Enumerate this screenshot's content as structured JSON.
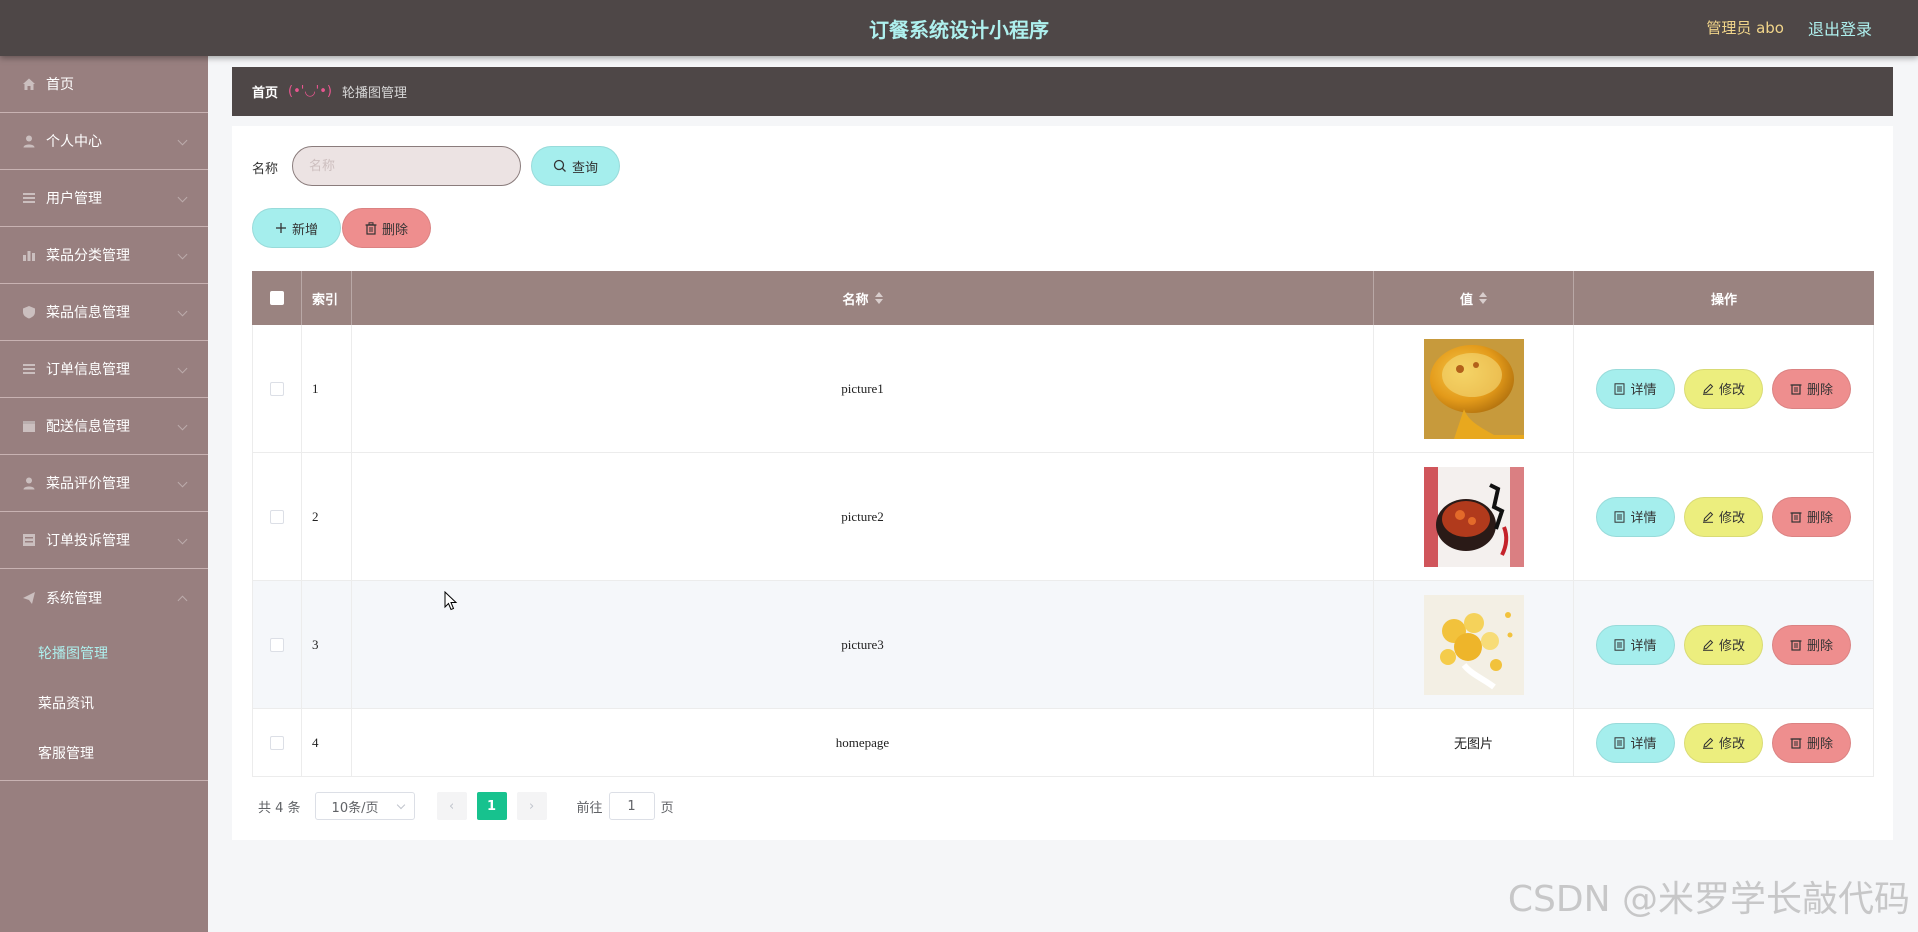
{
  "app": {
    "title": "订餐系统设计小程序",
    "user_label": "管理员 abo",
    "logout_label": "退出登录"
  },
  "sidebar": {
    "items": [
      {
        "label": "首页",
        "icon": "home-icon",
        "expandable": false
      },
      {
        "label": "个人中心",
        "icon": "user-icon",
        "expandable": true
      },
      {
        "label": "用户管理",
        "icon": "list-icon",
        "expandable": true
      },
      {
        "label": "菜品分类管理",
        "icon": "chart-icon",
        "expandable": true
      },
      {
        "label": "菜品信息管理",
        "icon": "shield-icon",
        "expandable": true
      },
      {
        "label": "订单信息管理",
        "icon": "list-icon",
        "expandable": true
      },
      {
        "label": "配送信息管理",
        "icon": "calendar-icon",
        "expandable": true
      },
      {
        "label": "菜品评价管理",
        "icon": "user-icon",
        "expandable": true
      },
      {
        "label": "订单投诉管理",
        "icon": "grid-icon",
        "expandable": true
      },
      {
        "label": "系统管理",
        "icon": "send-icon",
        "expandable": true,
        "expanded": true
      }
    ],
    "sub_items": [
      {
        "label": "轮播图管理",
        "active": true
      },
      {
        "label": "菜品资讯",
        "active": false
      },
      {
        "label": "客服管理",
        "active": false
      }
    ]
  },
  "breadcrumb": {
    "home": "首页",
    "separator": "(•'◡'•)",
    "current": "轮播图管理"
  },
  "search": {
    "label": "名称",
    "placeholder": "名称",
    "value": "",
    "button_label": "查询"
  },
  "toolbar": {
    "add_label": "新增",
    "delete_label": "删除"
  },
  "table": {
    "columns": [
      "索引",
      "名称",
      "值",
      "操作"
    ],
    "rows": [
      {
        "index": "1",
        "name": "picture1",
        "value_type": "image",
        "value_text": "",
        "image": "food-photo-honey"
      },
      {
        "index": "2",
        "name": "picture2",
        "value_type": "image",
        "value_text": "",
        "image": "food-photo-hunan-dish"
      },
      {
        "index": "3",
        "name": "picture3",
        "value_type": "image",
        "value_text": "",
        "image": "food-photo-corn-snack"
      },
      {
        "index": "4",
        "name": "homepage",
        "value_type": "text",
        "value_text": "无图片",
        "image": ""
      }
    ],
    "row_actions": {
      "detail": "详情",
      "edit": "修改",
      "delete": "删除"
    }
  },
  "pagination": {
    "total_label": "共 4 条",
    "page_size_label": "10条/页",
    "current_page": "1",
    "goto_prefix": "前往",
    "goto_value": "1",
    "goto_suffix": "页"
  },
  "watermark": "CSDN @米罗学长敲代码",
  "colors": {
    "topbar": "#4e4747",
    "sidebar": "#987f7f",
    "accent_cyan": "#a5eeed",
    "accent_red": "#ee8e8e",
    "accent_yellow": "#ecee7e",
    "table_header": "#9a8380",
    "page_active": "#17c28e"
  }
}
